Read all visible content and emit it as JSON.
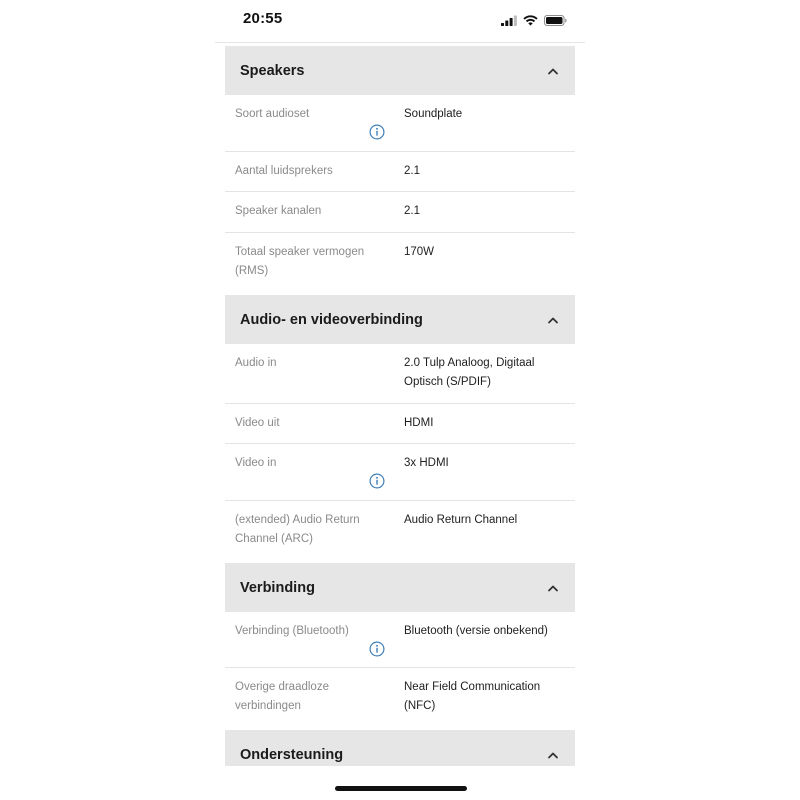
{
  "status_bar": {
    "time": "20:55",
    "icons": [
      "signal-icon",
      "wifi-icon",
      "battery-icon"
    ]
  },
  "sections": [
    {
      "title": "Speakers",
      "expanded": true,
      "rows": [
        {
          "label": "Soort audioset",
          "value": "Soundplate",
          "info": true
        },
        {
          "label": "Aantal luidsprekers",
          "value": "2.1",
          "info": false
        },
        {
          "label": "Speaker kanalen",
          "value": "2.1",
          "info": false
        },
        {
          "label": "Totaal speaker vermogen (RMS)",
          "value": "170W",
          "info": false
        }
      ]
    },
    {
      "title": "Audio- en videoverbinding",
      "expanded": true,
      "rows": [
        {
          "label": "Audio in",
          "value": "2.0 Tulp Analoog, Digitaal Optisch (S/PDIF)",
          "info": false
        },
        {
          "label": "Video uit",
          "value": "HDMI",
          "info": false
        },
        {
          "label": "Video in",
          "value": "3x HDMI",
          "info": true
        },
        {
          "label": "(extended) Audio Return Channel (ARC)",
          "value": "Audio Return Channel",
          "info": false
        }
      ]
    },
    {
      "title": "Verbinding",
      "expanded": true,
      "rows": [
        {
          "label": "Verbinding (Bluetooth)",
          "value": "Bluetooth (versie onbekend)",
          "info": true
        },
        {
          "label": "Overige draadloze verbindingen",
          "value": "Near Field Communication (NFC)",
          "info": false
        }
      ]
    },
    {
      "title": "Ondersteuning",
      "expanded": true,
      "rows": []
    }
  ],
  "colors": {
    "header_bg": "#e6e6e6",
    "label": "#8a8a8a",
    "value": "#1e1e1e",
    "info_icon": "#3f7fb8"
  }
}
